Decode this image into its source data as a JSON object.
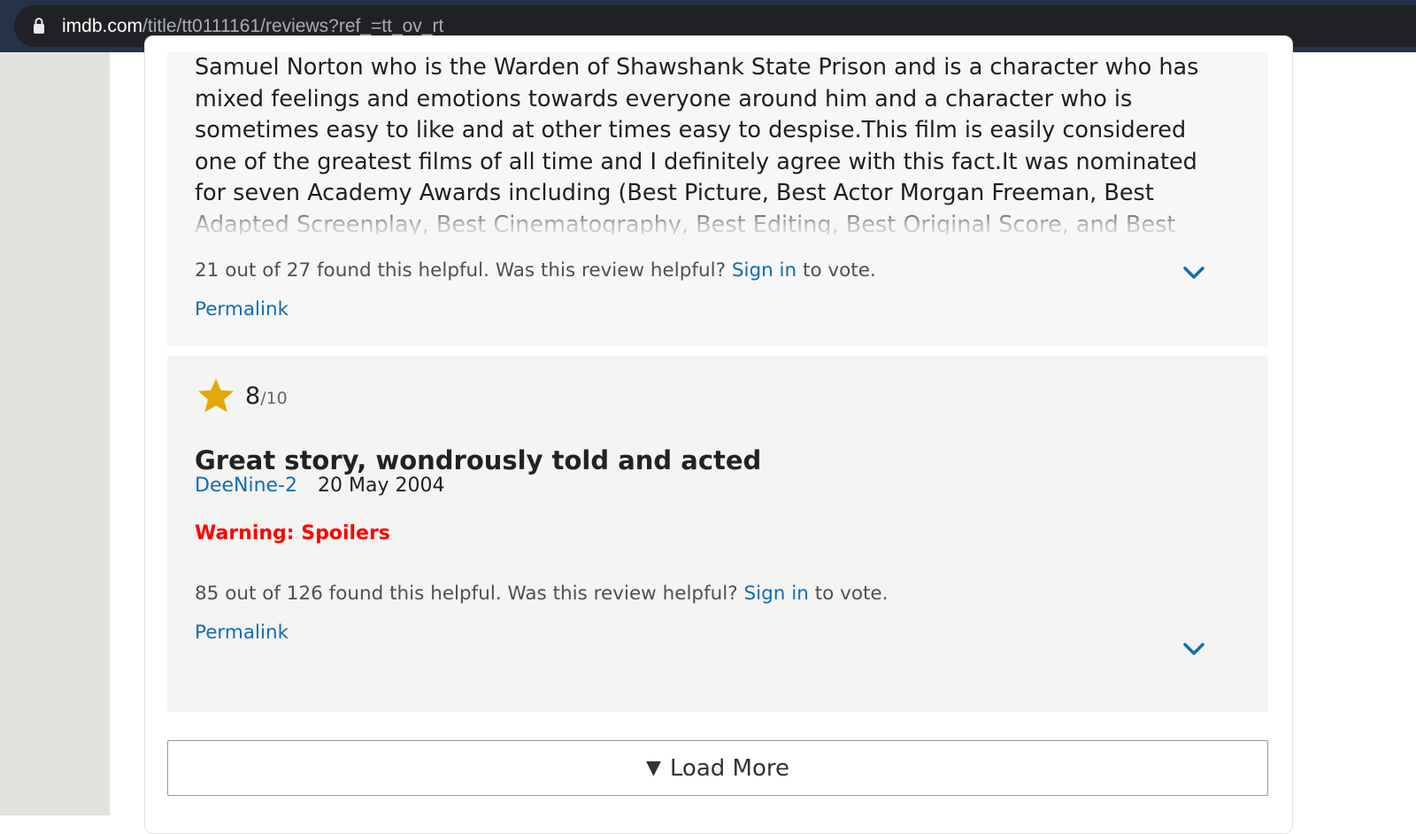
{
  "browser": {
    "url_domain": "imdb.com",
    "url_path": "/title/tt0111161/reviews?ref_=tt_ov_rt"
  },
  "reviews": [
    {
      "body": "Samuel Norton who is the Warden of Shawshank State Prison and is a character who has\nmixed feelings and emotions towards everyone around him and a character who is\nsometimes easy to like and at other times easy to despise.This film is easily considered\none of the greatest films of all time and I definitely agree with this fact.It was nominated\nfor seven Academy Awards including (Best Picture, Best Actor     Morgan Freeman, Best\nAdapted Screenplay, Best Cinematography, Best Editing, Best Original Score, and Best",
      "helpful_text": "21 out of 27 found this helpful. Was this review helpful?",
      "sign_in_label": "Sign in",
      "vote_suffix": "to vote.",
      "permalink_label": "Permalink"
    },
    {
      "rating": "8",
      "rating_scale": "/10",
      "title": "Great story, wondrously told and acted",
      "author": "DeeNine-2",
      "date": "20 May 2004",
      "spoiler_warning": "Warning: Spoilers",
      "helpful_text": "85 out of 126 found this helpful. Was this review helpful?",
      "sign_in_label": "Sign in",
      "vote_suffix": "to vote.",
      "permalink_label": "Permalink"
    }
  ],
  "load_more": {
    "arrow": "▼",
    "label": "Load More"
  },
  "colors": {
    "link": "#136cb2",
    "star": "#e2a80c",
    "spoiler": "#ff0000"
  },
  "icons": [
    "lock-icon",
    "star-icon",
    "chevron-down-icon"
  ]
}
